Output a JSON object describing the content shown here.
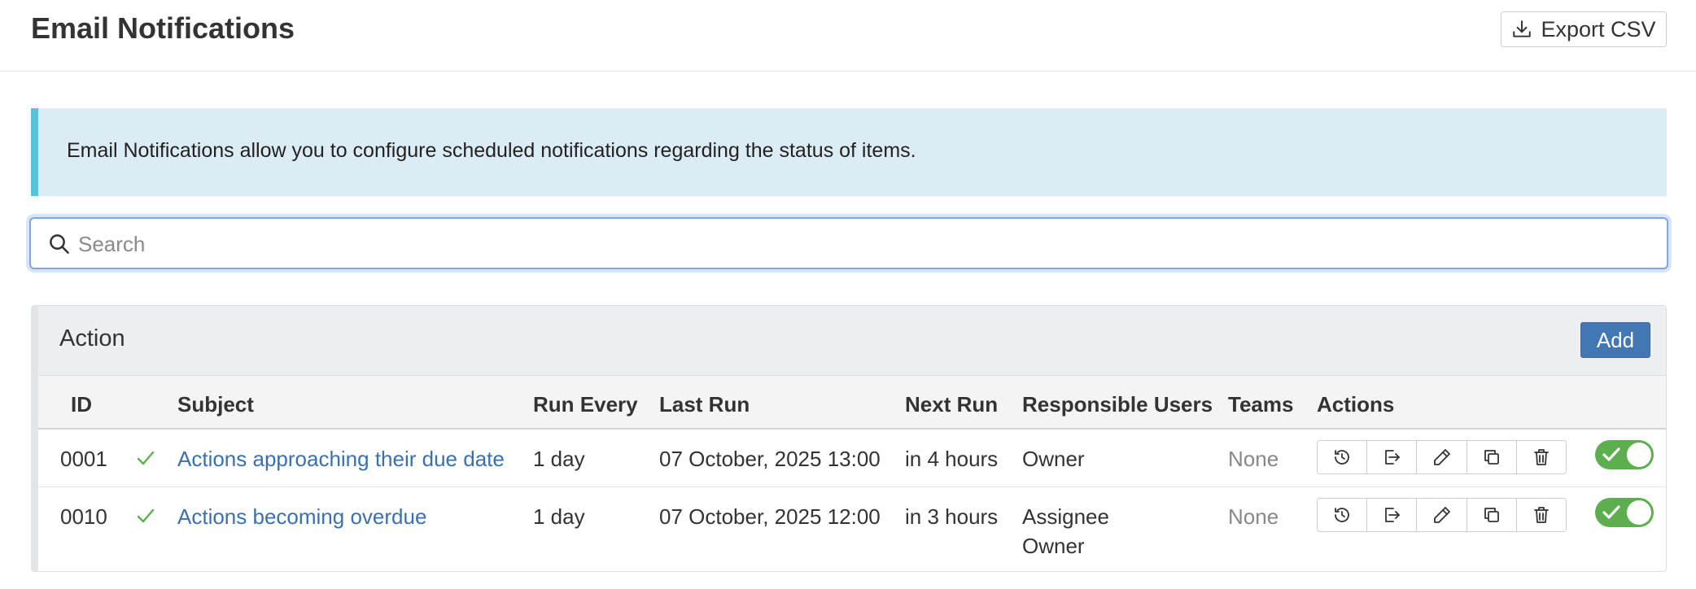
{
  "page": {
    "title": "Email Notifications",
    "export_label": "Export CSV"
  },
  "info": {
    "text": "Email Notifications allow you to configure scheduled notifications regarding the status of items."
  },
  "search": {
    "placeholder": "Search",
    "value": ""
  },
  "panel": {
    "title": "Action",
    "add_label": "Add"
  },
  "table": {
    "columns": [
      "ID",
      "Subject",
      "Run Every",
      "Last Run",
      "Next Run",
      "Responsible Users",
      "Teams",
      "Actions"
    ],
    "rows": [
      {
        "id": "0001",
        "subject": "Actions approaching their due date",
        "run_every": "1 day",
        "last_run": "07 October, 2025 13:00",
        "next_run": "in 4 hours",
        "users": [
          "Owner"
        ],
        "teams": "None",
        "enabled": true
      },
      {
        "id": "0010",
        "subject": "Actions becoming overdue",
        "run_every": "1 day",
        "last_run": "07 October, 2025 12:00",
        "next_run": "in 3 hours",
        "users": [
          "Assignee",
          "Owner"
        ],
        "teams": "None",
        "enabled": true
      }
    ],
    "row_actions": [
      "history-icon",
      "log-out-icon",
      "pencil-icon",
      "copy-icon",
      "trash-icon"
    ]
  },
  "colors": {
    "accent": "#4277b4",
    "link": "#3a70b0",
    "success": "#5cae4e",
    "info_bg": "#dcecf5",
    "info_border": "#5bc0de"
  }
}
